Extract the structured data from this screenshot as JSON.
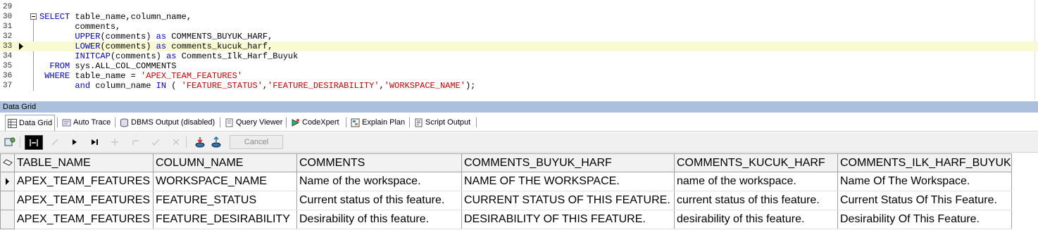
{
  "editor": {
    "lines": [
      {
        "num": "29",
        "parts": []
      },
      {
        "num": "30",
        "parts": [
          [
            "kw",
            "SELECT"
          ],
          [
            "t",
            " table_name,column_name,"
          ]
        ]
      },
      {
        "num": "31",
        "parts": [
          [
            "t",
            "       comments,"
          ]
        ]
      },
      {
        "num": "32",
        "parts": [
          [
            "t",
            "       "
          ],
          [
            "kw",
            "UPPER"
          ],
          [
            "t",
            "(comments) "
          ],
          [
            "kw",
            "as"
          ],
          [
            "t",
            " COMMENTS_BUYUK_HARF,"
          ]
        ]
      },
      {
        "num": "33",
        "parts": [
          [
            "t",
            "       "
          ],
          [
            "kw",
            "LOWER"
          ],
          [
            "t",
            "(comments) "
          ],
          [
            "kw",
            "as"
          ],
          [
            "t",
            " comments_kucuk_harf,"
          ]
        ]
      },
      {
        "num": "34",
        "parts": [
          [
            "t",
            "       "
          ],
          [
            "kw",
            "INITCAP"
          ],
          [
            "t",
            "(comments) "
          ],
          [
            "kw",
            "as"
          ],
          [
            "t",
            " Comments_Ilk_Harf_Buyuk"
          ]
        ]
      },
      {
        "num": "35",
        "parts": [
          [
            "t",
            "  "
          ],
          [
            "kw",
            "FROM"
          ],
          [
            "t",
            " sys.ALL_COL_COMMENTS"
          ]
        ]
      },
      {
        "num": "36",
        "parts": [
          [
            "t",
            " "
          ],
          [
            "kw",
            "WHERE"
          ],
          [
            "t",
            " table_name = "
          ],
          [
            "str",
            "'APEX_TEAM_FEATURES'"
          ]
        ]
      },
      {
        "num": "37",
        "parts": [
          [
            "t",
            "       "
          ],
          [
            "kw",
            "and"
          ],
          [
            "t",
            " column_name "
          ],
          [
            "kw",
            "IN"
          ],
          [
            "t",
            " ( "
          ],
          [
            "str",
            "'FEATURE_STATUS'"
          ],
          [
            "t",
            ","
          ],
          [
            "str",
            "'FEATURE_DESIRABILITY'"
          ],
          [
            "t",
            ","
          ],
          [
            "str",
            "'WORKSPACE_NAME'"
          ],
          [
            "t",
            ");"
          ]
        ]
      }
    ],
    "current_line": "33"
  },
  "panel": {
    "title": "Data Grid"
  },
  "tabs": [
    {
      "label": "Data Grid",
      "icon": "grid-icon",
      "active": true
    },
    {
      "label": "Auto Trace",
      "icon": "trace-icon",
      "active": false
    },
    {
      "label": "DBMS Output (disabled)",
      "icon": "dbms-output-icon",
      "active": false
    },
    {
      "label": "Query Viewer",
      "icon": "query-viewer-icon",
      "active": false
    },
    {
      "label": "CodeXpert",
      "icon": "codexpert-icon",
      "active": false
    },
    {
      "label": "Explain Plan",
      "icon": "explain-plan-icon",
      "active": false
    },
    {
      "label": "Script Output",
      "icon": "script-output-icon",
      "active": false
    }
  ],
  "toolbar": {
    "cancel_label": "Cancel"
  },
  "grid": {
    "columns": [
      "TABLE_NAME",
      "COLUMN_NAME",
      "COMMENTS",
      "COMMENTS_BUYUK_HARF",
      "COMMENTS_KUCUK_HARF",
      "COMMENTS_ILK_HARF_BUYUK"
    ],
    "rows": [
      [
        "APEX_TEAM_FEATURES",
        "WORKSPACE_NAME",
        "Name of the workspace.",
        "NAME OF THE WORKSPACE.",
        "name of the workspace.",
        "Name Of The Workspace."
      ],
      [
        "APEX_TEAM_FEATURES",
        "FEATURE_STATUS",
        "Current status of this feature.",
        "CURRENT STATUS OF THIS FEATURE.",
        "current status of this feature.",
        "Current Status Of This Feature."
      ],
      [
        "APEX_TEAM_FEATURES",
        "FEATURE_DESIRABILITY",
        "Desirability of this feature.",
        "DESIRABILITY OF THIS FEATURE.",
        "desirability of this feature.",
        "Desirability Of This Feature."
      ]
    ]
  }
}
